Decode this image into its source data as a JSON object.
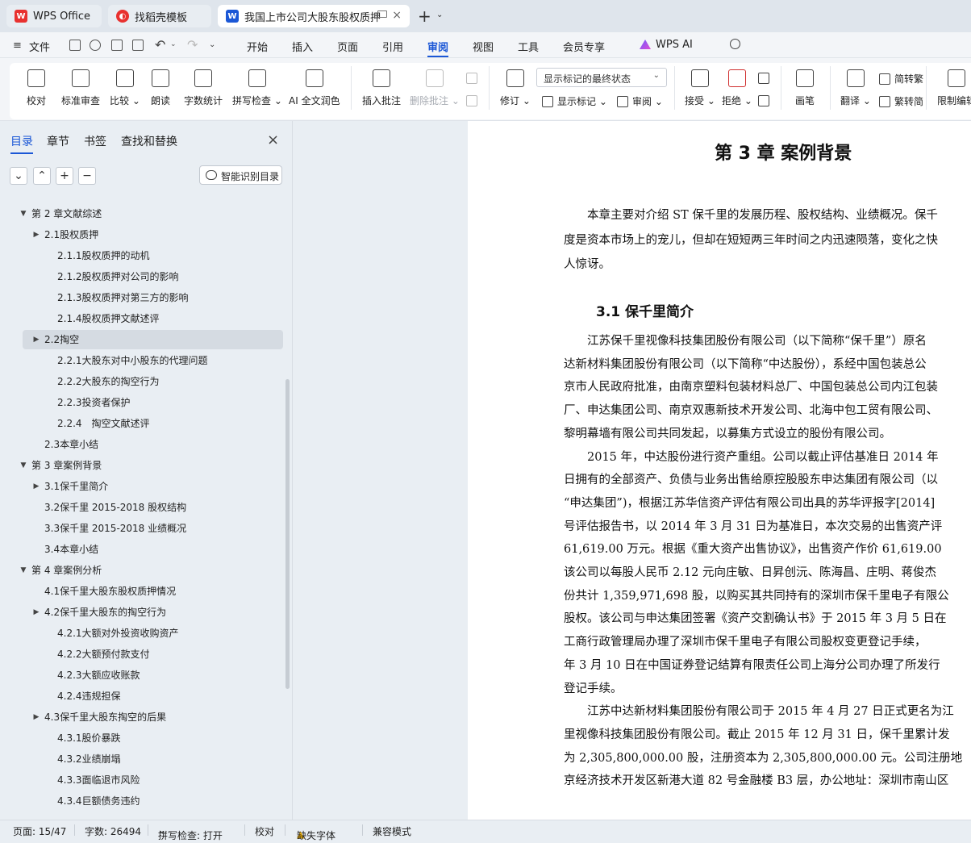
{
  "tabs": [
    {
      "label": "WPS Office",
      "icon": "wps-logo-icon",
      "active": false
    },
    {
      "label": "找稻壳模板",
      "icon": "docer-logo-icon",
      "active": false
    },
    {
      "label": "我国上市公司大股东股权质押",
      "icon": "word-doc-icon",
      "active": true
    }
  ],
  "menu": {
    "file": "文件",
    "items": [
      "开始",
      "插入",
      "页面",
      "引用",
      "审阅",
      "视图",
      "工具",
      "会员专享"
    ],
    "active": "审阅",
    "ai": "WPS AI"
  },
  "ribbon": {
    "proof": "校对",
    "std_review": "标准审查",
    "compare": "比较",
    "read_aloud": "朗读",
    "word_count": "字数统计",
    "spell_check": "拼写检查",
    "ai_polish": "AI 全文润色",
    "insert_comment": "插入批注",
    "delete_comment": "删除批注",
    "revise": "修订",
    "display_markup": "显示标记",
    "review": "审阅",
    "markup_select": "显示标记的最终状态",
    "accept": "接受",
    "reject": "拒绝",
    "pen": "画笔",
    "translate": "翻译",
    "to_trad": "简转繁",
    "to_simp": "繁转简",
    "restrict_edit": "限制编辑"
  },
  "nav": {
    "tabs": [
      "目录",
      "章节",
      "书签",
      "查找和替换"
    ],
    "smart_toc": "智能识别目录",
    "toc": [
      {
        "label": "第 2 章文献综述",
        "level": 1,
        "arrow": "down"
      },
      {
        "label": "2.1股权质押",
        "level": 2,
        "arrow": "right"
      },
      {
        "label": "2.1.1股权质押的动机",
        "level": 3,
        "arrow": ""
      },
      {
        "label": "2.1.2股权质押对公司的影响",
        "level": 3,
        "arrow": ""
      },
      {
        "label": "2.1.3股权质押对第三方的影响",
        "level": 3,
        "arrow": ""
      },
      {
        "label": "2.1.4股权质押文献述评",
        "level": 3,
        "arrow": ""
      },
      {
        "label": "2.2掏空",
        "level": 2,
        "arrow": "right",
        "selected": true
      },
      {
        "label": "2.2.1大股东对中小股东的代理问题",
        "level": 3,
        "arrow": ""
      },
      {
        "label": "2.2.2大股东的掏空行为",
        "level": 3,
        "arrow": ""
      },
      {
        "label": "2.2.3投资者保护",
        "level": 3,
        "arrow": ""
      },
      {
        "label": "2.2.4　掏空文献述评",
        "level": 3,
        "arrow": ""
      },
      {
        "label": "2.3本章小结",
        "level": 2,
        "arrow": ""
      },
      {
        "label": "第 3 章案例背景",
        "level": 1,
        "arrow": "down"
      },
      {
        "label": "3.1保千里简介",
        "level": 2,
        "arrow": "right"
      },
      {
        "label": "3.2保千里 2015-2018 股权结构",
        "level": 2,
        "arrow": ""
      },
      {
        "label": "3.3保千里 2015-2018 业绩概况",
        "level": 2,
        "arrow": ""
      },
      {
        "label": "3.4本章小结",
        "level": 2,
        "arrow": ""
      },
      {
        "label": "第 4 章案例分析",
        "level": 1,
        "arrow": "down"
      },
      {
        "label": "4.1保千里大股东股权质押情况",
        "level": 2,
        "arrow": ""
      },
      {
        "label": "4.2保千里大股东的掏空行为",
        "level": 2,
        "arrow": "right"
      },
      {
        "label": "4.2.1大额对外投资收购资产",
        "level": 3,
        "arrow": ""
      },
      {
        "label": "4.2.2大额预付款支付",
        "level": 3,
        "arrow": ""
      },
      {
        "label": "4.2.3大额应收账款",
        "level": 3,
        "arrow": ""
      },
      {
        "label": "4.2.4违规担保",
        "level": 3,
        "arrow": ""
      },
      {
        "label": "4.3保千里大股东掏空的后果",
        "level": 2,
        "arrow": "right"
      },
      {
        "label": "4.3.1股价暴跌",
        "level": 3,
        "arrow": ""
      },
      {
        "label": "4.3.2业绩崩塌",
        "level": 3,
        "arrow": ""
      },
      {
        "label": "4.3.3面临退市风险",
        "level": 3,
        "arrow": ""
      },
      {
        "label": "4.3.4巨额债务违约",
        "level": 3,
        "arrow": ""
      }
    ]
  },
  "document": {
    "chapter_title": "第 3 章  案例背景",
    "section_title": "3.1  保千里简介",
    "intro_lines": [
      "　　本章主要对介绍 ST 保千里的发展历程、股权结构、业绩概况。保千",
      "度是资本市场上的宠儿，但却在短短两三年时间之内迅速陨落，变化之快",
      "人惊讶。"
    ],
    "body_lines": [
      "　　江苏保千里视像科技集团股份有限公司（以下简称“保千里”）原名",
      "达新材料集团股份有限公司（以下简称“中达股份），系经中国包装总公",
      "京市人民政府批准，由南京塑料包装材料总厂、中国包装总公司内江包装",
      "厂、申达集团公司、南京双惠新技术开发公司、北海中包工贸有限公司、",
      "黎明幕墙有限公司共同发起，以募集方式设立的股份有限公司。",
      "　　2015 年，中达股份进行资产重组。公司以截止评估基准日 2014 年",
      "日拥有的全部资产、负债与业务出售给原控股股东申达集团有限公司（以",
      "“申达集团”)，根据江苏华信资产评估有限公司出具的苏华评报字[2014]",
      "号评估报告书，以 2014 年 3 月 31 日为基准日，本次交易的出售资产评",
      "61,619.00 万元。根据《重大资产出售协议》，出售资产作价 61,619.00",
      "该公司以每股人民币 2.12 元向庄敏、日昇创沅、陈海昌、庄明、蒋俊杰",
      "份共计 1,359,971,698 股，以购买其共同持有的深圳市保千里电子有限公",
      "股权。该公司与申达集团签署《资产交割确认书》于 2015 年 3 月 5 日在",
      "工商行政管理局办理了深圳市保千里电子有限公司股权变更登记手续，",
      "年 3 月 10 日在中国证券登记结算有限责任公司上海分公司办理了所发行",
      "登记手续。",
      "　　江苏中达新材料集团股份有限公司于 2015 年 4 月 27 日正式更名为江",
      "里视像科技集团股份有限公司。截止 2015 年 12 月 31 日，保千里累计发",
      "为 2,305,800,000.00 股，注册资本为 2,305,800,000.00 元。公司注册地",
      "京经济技术开发区新港大道 82 号金融楼 B3 层，办公地址：深圳市南山区"
    ]
  },
  "status": {
    "page": "页面: 15/47",
    "words": "字数: 26494",
    "spell": "拼写检查: 打开",
    "proof": "校对",
    "missing_font": "缺失字体",
    "compat": "兼容模式"
  },
  "colors": {
    "accent": "#1b57d6",
    "wps_red": "#e8312f"
  }
}
